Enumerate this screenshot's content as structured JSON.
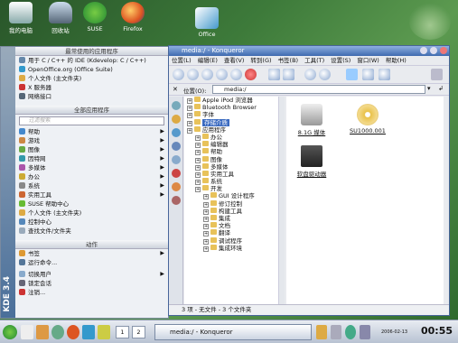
{
  "desktop": {
    "icons": [
      {
        "label": "我的电脑",
        "icon": "computer-icon"
      },
      {
        "label": "回收站",
        "icon": "trash-icon"
      },
      {
        "label": "SUSE",
        "icon": "suse-icon"
      },
      {
        "label": "Firefox",
        "icon": "firefox-icon"
      },
      {
        "label": "Office",
        "icon": "office-icon"
      }
    ]
  },
  "kmenu": {
    "side_label": "KDE 3.4",
    "section_frequent": "最常使用的应用程序",
    "frequent": [
      "用于 C / C++ 的 IDE (Kdevelop:  C / C++)",
      "OpenOffice.org (Office Suite)",
      "个人文件 (主文件夹)",
      "X 服务器",
      "网络接口"
    ],
    "section_all": "全部应用程序",
    "search_placeholder": "过滤搜索",
    "categories": [
      "帮助",
      "游戏",
      "图像",
      "因特网",
      "多媒体",
      "办公",
      "系统",
      "实用工具"
    ],
    "extra": [
      "SUSE 帮助中心",
      "个人文件 (主文件夹)",
      "控制中心",
      "查找文件/文件夹"
    ],
    "section_actions": "动作",
    "actions": [
      "书签",
      "运行命令...",
      "切换用户",
      "锁定会话",
      "注销..."
    ]
  },
  "window": {
    "title": "media:/ - Konqueror",
    "menu": [
      "位置(L)",
      "编辑(E)",
      "查看(V)",
      "转到(G)",
      "书签(B)",
      "工具(T)",
      "设置(S)",
      "窗口(W)",
      "帮助(H)"
    ],
    "location_label": "位置(O):",
    "location_value": "media:/",
    "tree": [
      {
        "label": "Apple iPod 浏览器",
        "level": 0
      },
      {
        "label": "Bluetooth Browser",
        "level": 0
      },
      {
        "label": "字体",
        "level": 0
      },
      {
        "label": "存储介质",
        "level": 0,
        "selected": true
      },
      {
        "label": "应用程序",
        "level": 0
      },
      {
        "label": "办公",
        "level": 1
      },
      {
        "label": "编辑器",
        "level": 1
      },
      {
        "label": "帮助",
        "level": 1
      },
      {
        "label": "图像",
        "level": 1
      },
      {
        "label": "多媒体",
        "level": 1
      },
      {
        "label": "实用工具",
        "level": 1
      },
      {
        "label": "系统",
        "level": 1
      },
      {
        "label": "开发",
        "level": 1
      },
      {
        "label": "GUI 设计程序",
        "level": 2
      },
      {
        "label": "修订控制",
        "level": 2
      },
      {
        "label": "构建工具",
        "level": 2
      },
      {
        "label": "集成",
        "level": 2
      },
      {
        "label": "文档",
        "level": 2
      },
      {
        "label": "翻译",
        "level": 2
      },
      {
        "label": "调试程序",
        "level": 2
      },
      {
        "label": "集成环境",
        "level": 2
      }
    ],
    "files": [
      {
        "label": "8.1G 媒体",
        "icon": "hard-disk-icon"
      },
      {
        "label": "SU1000.001",
        "icon": "cdrom-icon"
      },
      {
        "label": "软盘驱动器",
        "icon": "floppy-icon"
      }
    ],
    "status": "3 项 - 无文件 - 3 个文件夹"
  },
  "taskbar": {
    "pager": [
      "1",
      "2"
    ],
    "task": "media:/ - Konqueror",
    "date": "2006-02-13",
    "clock": "00:55"
  }
}
